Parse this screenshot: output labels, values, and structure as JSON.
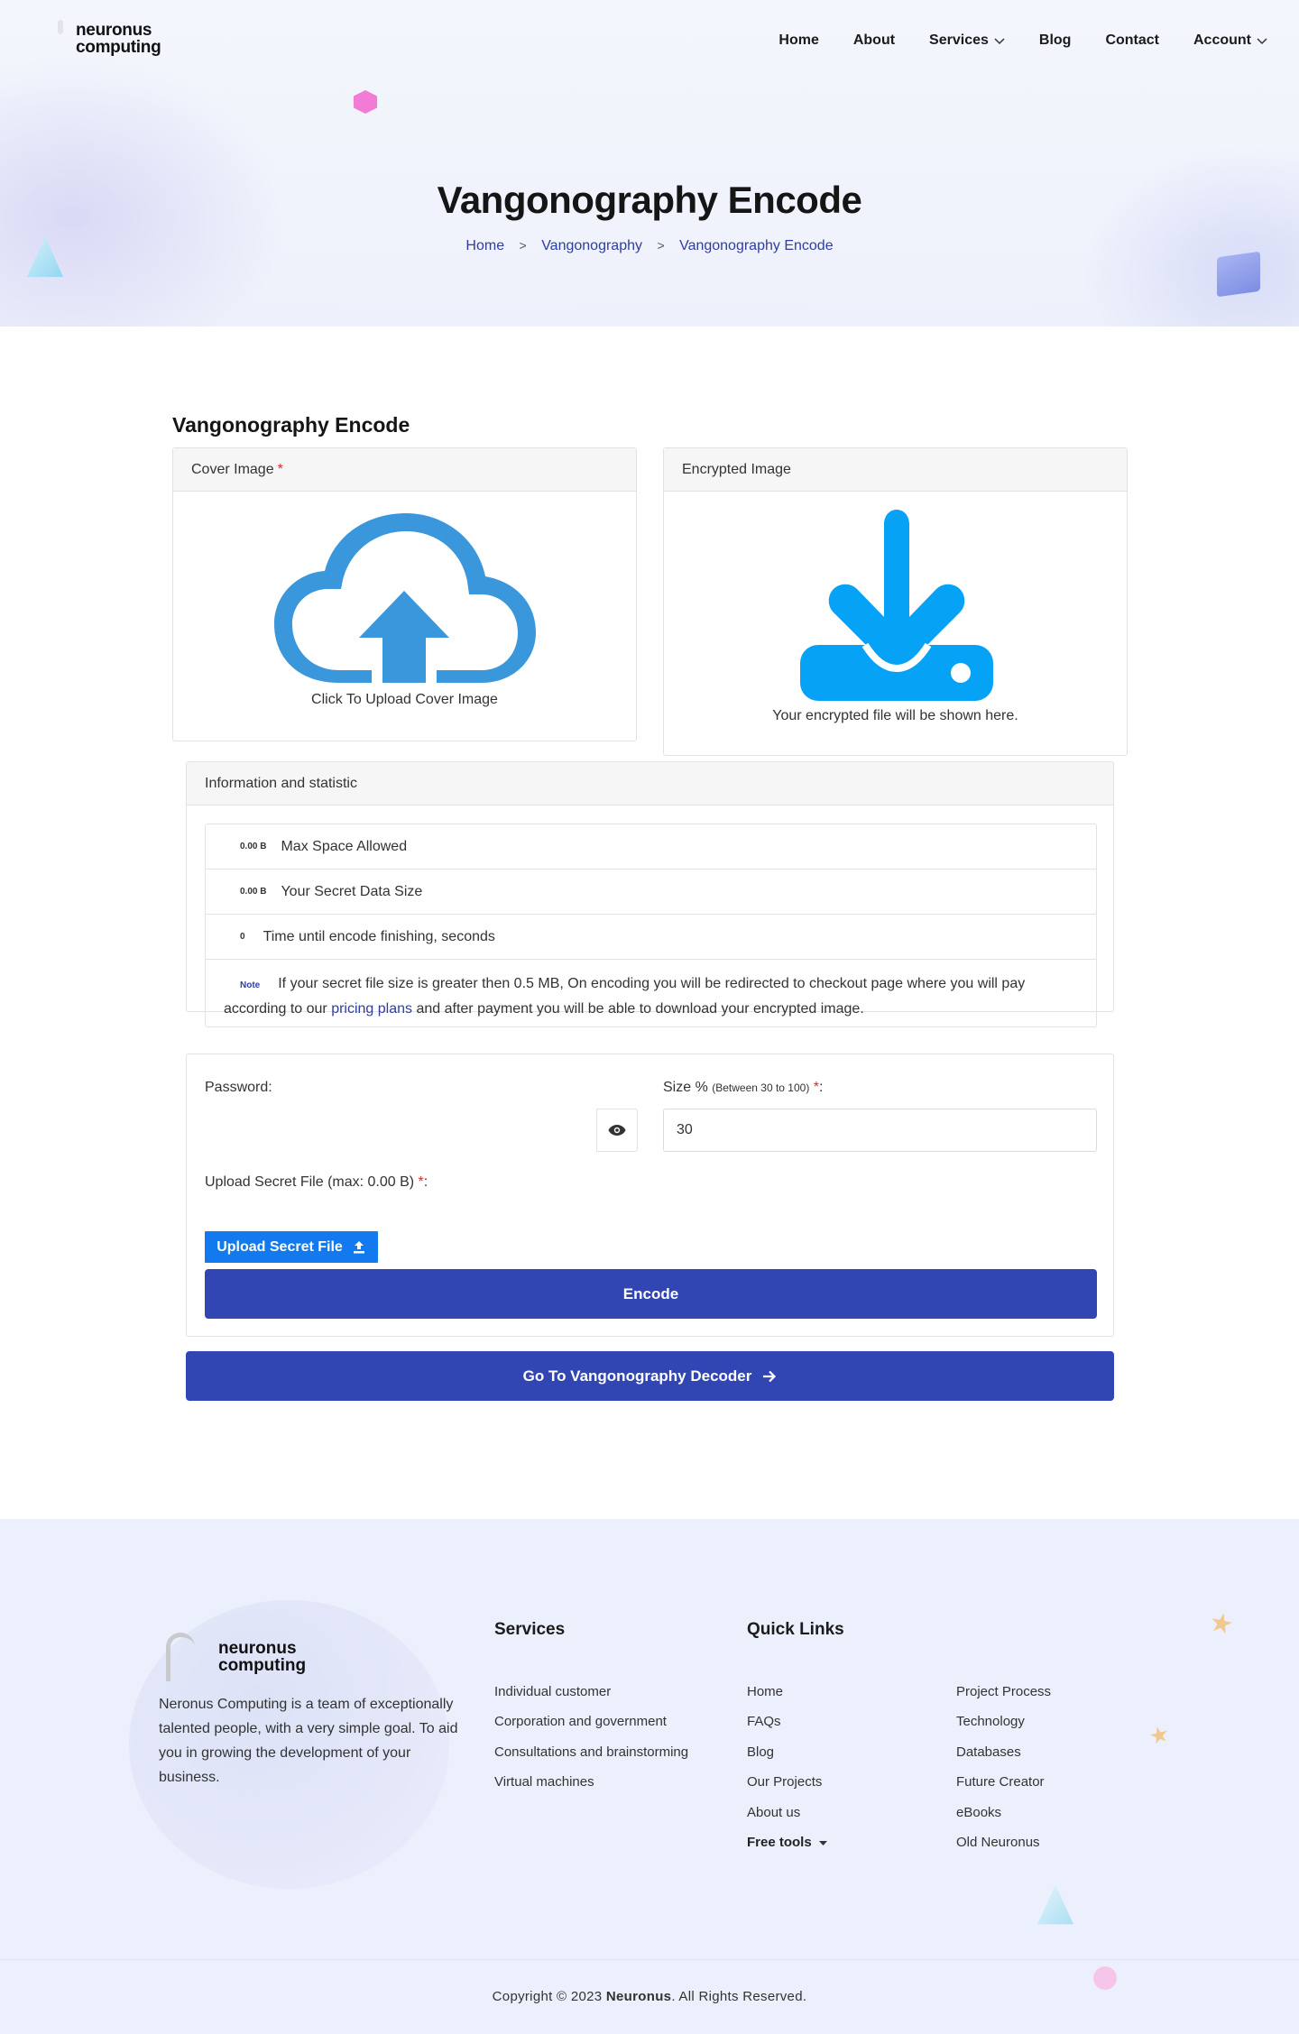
{
  "brand": {
    "line1": "neuronus",
    "line2": "computing"
  },
  "nav": [
    {
      "label": "Home",
      "dropdown": false
    },
    {
      "label": "About",
      "dropdown": false
    },
    {
      "label": "Services",
      "dropdown": true
    },
    {
      "label": "Blog",
      "dropdown": false
    },
    {
      "label": "Contact",
      "dropdown": false
    },
    {
      "label": "Account",
      "dropdown": true
    }
  ],
  "hero": {
    "title": "Vangonography Encode",
    "breadcrumb": [
      "Home",
      "Vangonography",
      "Vangonography Encode"
    ],
    "breadcrumb_sep": ">"
  },
  "main": {
    "section_title": "Vangonography Encode",
    "cover": {
      "label": "Cover Image",
      "required": "*",
      "caption": "Click To Upload Cover Image",
      "icon": "cloud-upload-icon",
      "icon_color": "#3a97dc"
    },
    "encrypted": {
      "label": "Encrypted Image",
      "caption": "Your encrypted file will be shown here.",
      "icon": "download-icon",
      "icon_color": "#05a2f5"
    },
    "info": {
      "title": "Information and statistic",
      "rows": [
        {
          "badge": "0.00 B",
          "text": "Max Space Allowed"
        },
        {
          "badge": "0.00 B",
          "text": "Your Secret Data Size"
        },
        {
          "badge": "0",
          "text": "Time until encode finishing, seconds"
        }
      ],
      "note": {
        "badge": "Note",
        "before": "If your secret file size is greater then 0.5 MB, On encoding you will be redirected to checkout page where you will pay according to our ",
        "link": "pricing plans",
        "after": " and after payment you will be able to download your encrypted image."
      }
    },
    "form": {
      "password_label": "Password:",
      "password_value": "",
      "size_label": "Size %",
      "size_hint": "(Between 30 to 100)",
      "size_required": "*",
      "size_colon": ":",
      "size_value": "30",
      "upload_label": "Upload Secret File (max: 0.00 B)",
      "upload_required": "*",
      "upload_colon": ":",
      "upload_button": "Upload Secret File",
      "encode_button": "Encode"
    },
    "decoder_button": "Go To Vangonography Decoder"
  },
  "footer": {
    "description": "Neronus Computing is a team of exceptionally talented people, with a very simple goal. To aid you in growing the development of your business.",
    "services_title": "Services",
    "services": [
      "Individual customer",
      "Corporation and government",
      "Consultations and brainstorming",
      "Virtual machines"
    ],
    "quick_title": "Quick Links",
    "quick_col1": [
      "Home",
      "FAQs",
      "Blog",
      "Our Projects",
      "About us",
      "Free tools"
    ],
    "quick_col2": [
      "Project Process",
      "Technology",
      "Databases",
      "Future Creator",
      "eBooks",
      "Old Neuronus"
    ],
    "copyright_before": "Copyright © 2023 ",
    "copyright_brand": "Neuronus",
    "copyright_after": ". All Rights Reserved."
  },
  "colors": {
    "primary": "#3146b3",
    "upload_button": "#1279ee",
    "required": "#d42d2d",
    "link": "#2f3e9e"
  }
}
